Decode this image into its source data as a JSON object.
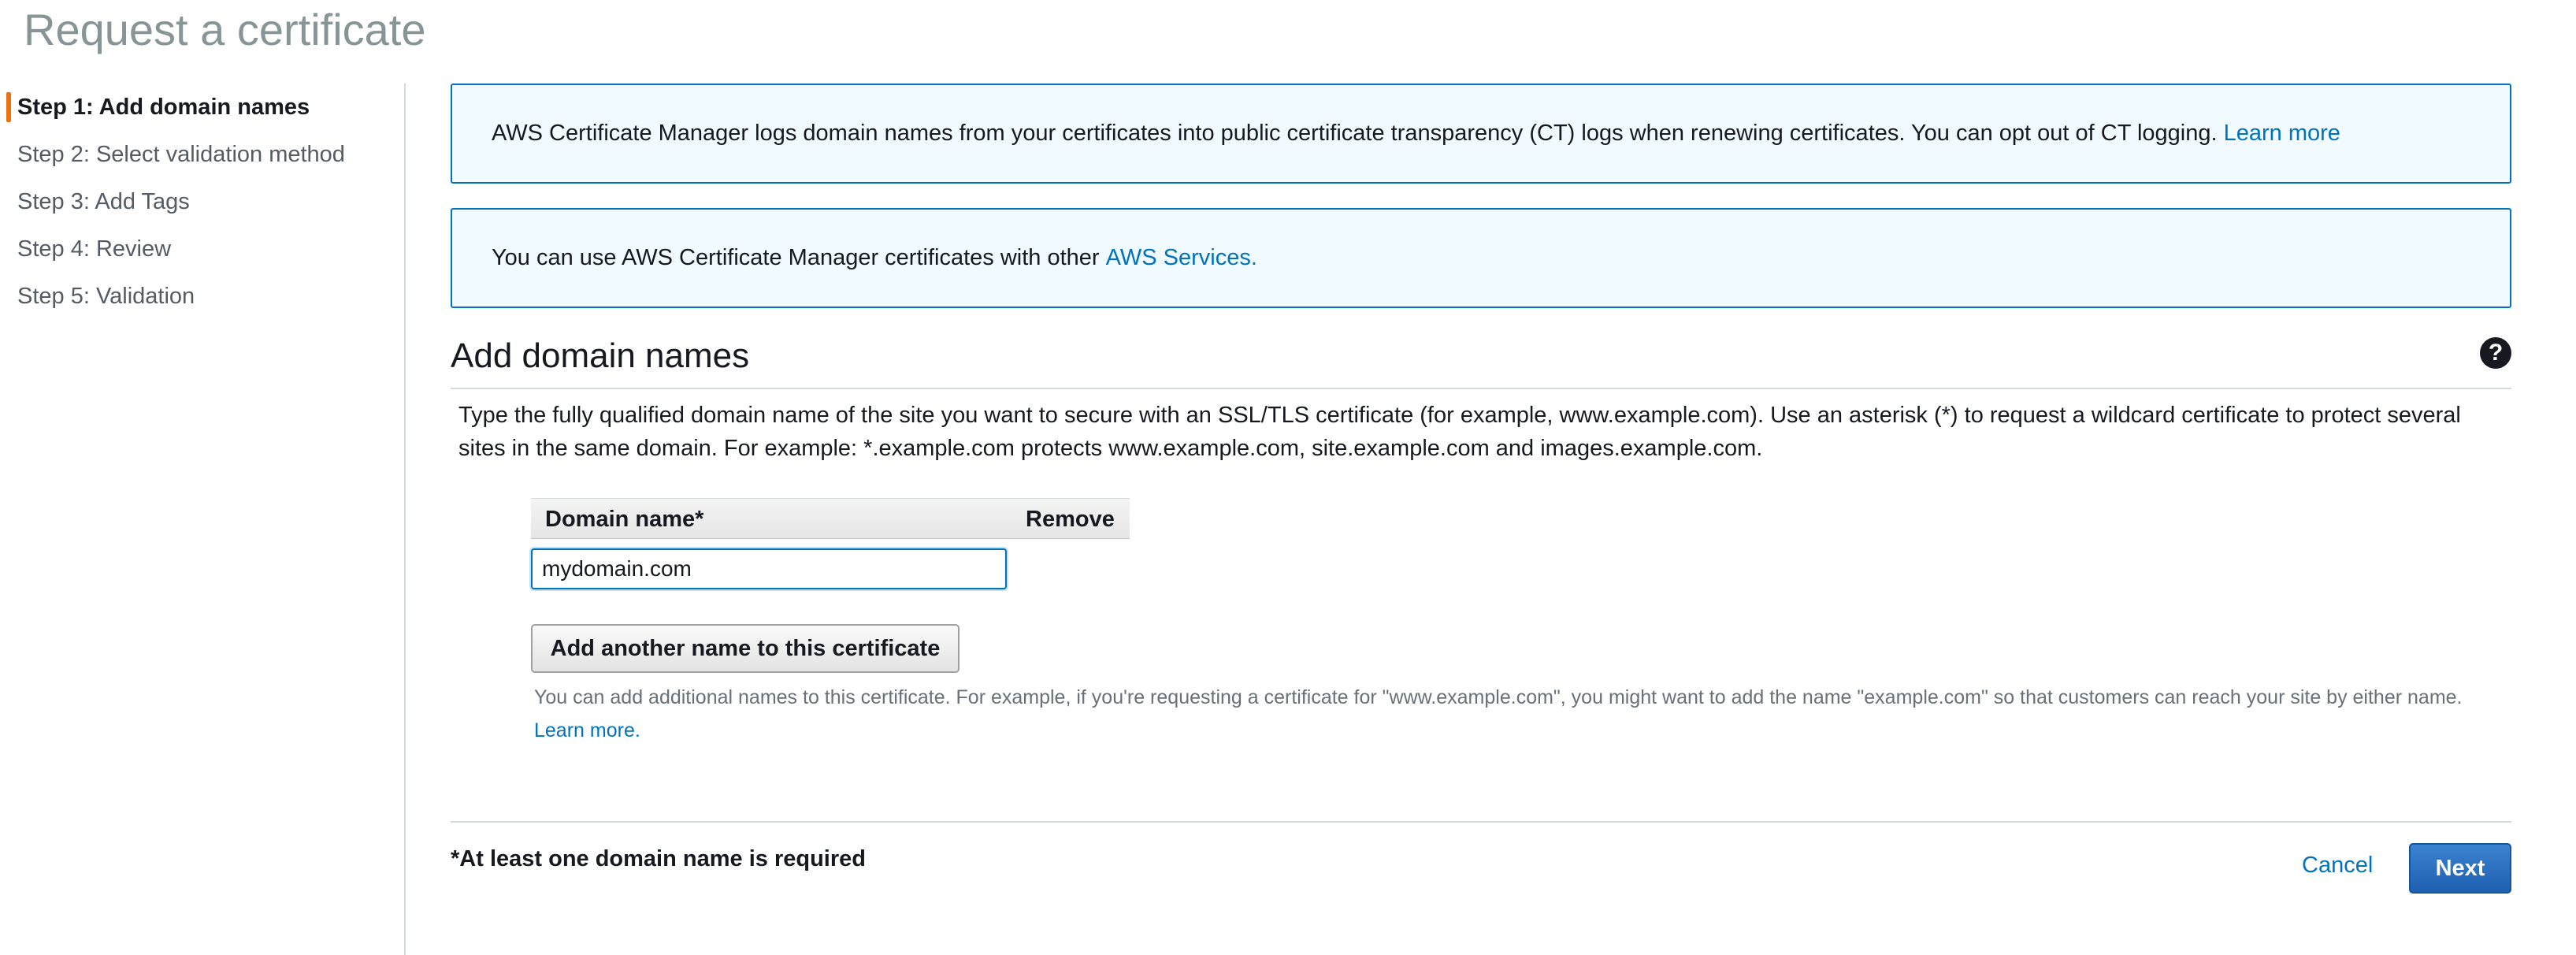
{
  "page": {
    "title": "Request a certificate"
  },
  "sidebar": {
    "steps": [
      {
        "label": "Step 1: Add domain names",
        "active": true
      },
      {
        "label": "Step 2: Select validation method",
        "active": false
      },
      {
        "label": "Step 3: Add Tags",
        "active": false
      },
      {
        "label": "Step 4: Review",
        "active": false
      },
      {
        "label": "Step 5: Validation",
        "active": false
      }
    ]
  },
  "alerts": {
    "ct_logging": {
      "text": "AWS Certificate Manager logs domain names from your certificates into public certificate transparency (CT) logs when renewing certificates. You can opt out of CT logging.",
      "link": "Learn more"
    },
    "services": {
      "text": "You can use AWS Certificate Manager certificates with other",
      "link": "AWS Services."
    }
  },
  "section": {
    "title": "Add domain names",
    "help_icon": "question-circle-icon",
    "description": "Type the fully qualified domain name of the site you want to secure with an SSL/TLS certificate (for example, www.example.com). Use an asterisk (*) to request a wildcard certificate to protect several sites in the same domain. For example: *.example.com protects www.example.com, site.example.com and images.example.com."
  },
  "domain_table": {
    "col_domain": "Domain name*",
    "col_remove": "Remove",
    "input_value": "mydomain.com"
  },
  "add_button": {
    "label": "Add another name to this certificate"
  },
  "hint": {
    "text": "You can add additional names to this certificate. For example, if you're requesting a certificate for \"www.example.com\", you might want to add the name \"example.com\" so that customers can reach your site by either name.",
    "link": "Learn more."
  },
  "footer": {
    "required_note": "*At least one domain name is required",
    "cancel_label": "Cancel",
    "next_label": "Next"
  }
}
